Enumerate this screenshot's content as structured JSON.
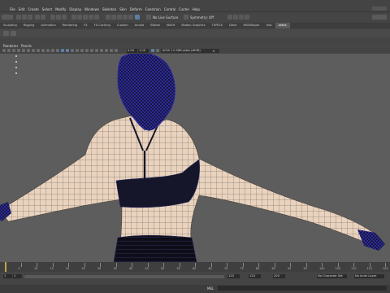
{
  "menus": [
    "File",
    "Edit",
    "Create",
    "Select",
    "Modify",
    "Display",
    "Windows",
    "Skeleton",
    "Skin",
    "Deform",
    "Constrain",
    "Control",
    "Cache",
    "Help"
  ],
  "status": {
    "no_live_surface": "No Live Surface",
    "symmetry": "Symmetry: Off"
  },
  "shelf_tabs": [
    "Sculpting",
    "Rigging",
    "Animation",
    "Rendering",
    "FX",
    "FX Caching",
    "Custom",
    "Arnold",
    "Bifrost",
    "MASH",
    "Motion Graphics",
    "TURTLE",
    "Dave",
    "MODifiguer",
    "test",
    "zebra"
  ],
  "shelf_active": "zebra",
  "panel_menu": {
    "renderer": "Renderer",
    "panels": "Panels"
  },
  "panel_tool": {
    "near": "0.00",
    "far": "1.00",
    "camera": "ACES 1.0 SDR-video (sRGB)"
  },
  "timeline": {
    "ticks": [
      "5",
      "10",
      "15",
      "20",
      "25",
      "30",
      "35",
      "40",
      "45",
      "50",
      "55",
      "60",
      "65",
      "70",
      "75",
      "80",
      "85",
      "90",
      "95",
      "100",
      "105",
      "110",
      "115",
      "120"
    ]
  },
  "range": {
    "start_a": "1",
    "start_b": "1",
    "end_a": "120",
    "end_b": "120",
    "end_c": "200",
    "character_set": "No Character Set",
    "anim_layer": "No Anim Layer"
  },
  "cmdline": {
    "lang": "MEL"
  },
  "colors": {
    "mesh_skin": "#e9d3be",
    "mesh_line": "#555555",
    "hair_wire": "#2f2aa8",
    "bra": "#16162a",
    "viewport_bg": "#5d5d5d"
  }
}
